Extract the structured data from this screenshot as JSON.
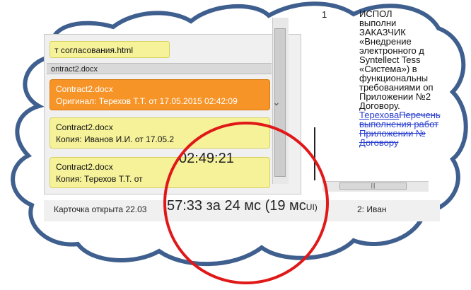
{
  "colors": {
    "orange": "#f79428",
    "yellow": "#f6f29a",
    "link": "#2a3fd0",
    "circle": "#e01818",
    "cloud_stroke": "#3f5f8f"
  },
  "list": {
    "html_item": "т согласования.html",
    "group_header": "ontract2.docx",
    "cards": [
      {
        "line1": "Contract2.docx",
        "line2": "Оригинал: Терехов Т.Т.   от 17.05.2015 02:42:09"
      },
      {
        "line1": "Contract2.docx",
        "line2": "Копия: Иванов И.И.   от 17.05.2"
      },
      {
        "line1": "Contract2.docx",
        "line2": "Копия: Терехов Т.Т.   от"
      }
    ],
    "time_overlay": "02:49:21"
  },
  "doc": {
    "num": "1",
    "lines": [
      "ИСПОЛ",
      "выполни",
      "ЗАКАЗЧИК",
      "«Внедрение",
      "электронного  д",
      "Syntellect    Tess",
      "«Система»)    в",
      "функциональны",
      "требованиями  оп",
      "Приложении  №2",
      "Договору."
    ],
    "link1": "Терехова",
    "strike1": "Перечень",
    "strike2": "выполнения работ",
    "strike3": "Приложении  №",
    "strike4": "Договору"
  },
  "status": {
    "left": "Карточка открыта 22.03",
    "big": "57:33 за 24 мс (19 мс",
    "mid": "UI)",
    "right": "2:  Иван"
  },
  "icons": {
    "hscroll_grip": "grip-icon",
    "chevron": "chevron-down-icon"
  }
}
